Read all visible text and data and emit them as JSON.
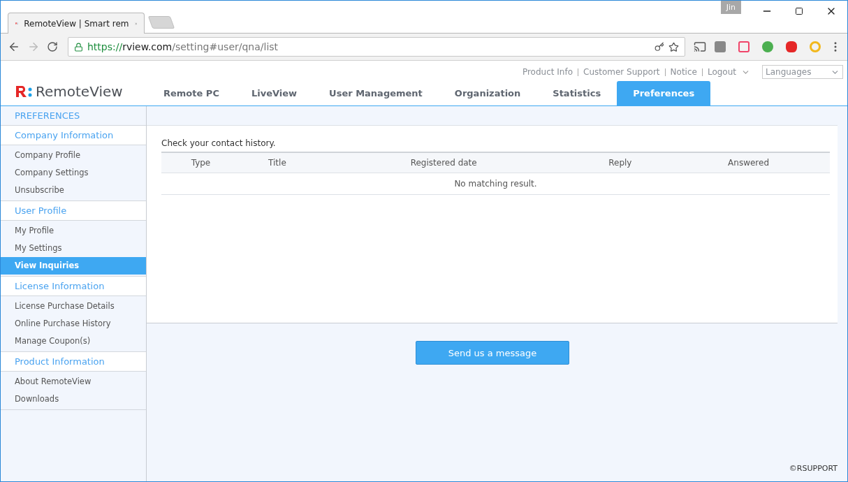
{
  "browser": {
    "tab_title": "RemoteView | Smart rem",
    "profile": "Jin",
    "url": {
      "scheme": "https://",
      "host": "rview.com",
      "path": "/setting#user/qna/list"
    }
  },
  "header": {
    "logo": "RemoteView",
    "top_links": [
      "Product Info",
      "Customer Support",
      "Notice",
      "Logout"
    ],
    "language_select": "Languages",
    "nav": [
      {
        "label": "Remote PC",
        "selected": false
      },
      {
        "label": "LiveView",
        "selected": false
      },
      {
        "label": "User Management",
        "selected": false
      },
      {
        "label": "Organization",
        "selected": false
      },
      {
        "label": "Statistics",
        "selected": false
      },
      {
        "label": "Preferences",
        "selected": true
      }
    ]
  },
  "sidebar": {
    "title": "PREFERENCES",
    "sections": [
      {
        "heading": "Company Information",
        "items": [
          {
            "label": "Company Profile",
            "selected": false
          },
          {
            "label": "Company Settings",
            "selected": false
          },
          {
            "label": "Unsubscribe",
            "selected": false
          }
        ]
      },
      {
        "heading": "User Profile",
        "items": [
          {
            "label": "My Profile",
            "selected": false
          },
          {
            "label": "My Settings",
            "selected": false
          },
          {
            "label": "View Inquiries",
            "selected": true
          }
        ]
      },
      {
        "heading": "License Information",
        "items": [
          {
            "label": "License Purchase Details",
            "selected": false
          },
          {
            "label": "Online Purchase History",
            "selected": false
          },
          {
            "label": "Manage Coupon(s)",
            "selected": false
          }
        ]
      },
      {
        "heading": "Product Information",
        "items": [
          {
            "label": "About RemoteView",
            "selected": false
          },
          {
            "label": "Downloads",
            "selected": false
          }
        ]
      }
    ]
  },
  "content": {
    "intro": "Check your contact history.",
    "table": {
      "columns": [
        "Type",
        "Title",
        "Registered date",
        "Reply",
        "Answered"
      ],
      "empty_message": "No matching result."
    },
    "send_button": "Send us a message"
  },
  "footer": "©RSUPPORT"
}
